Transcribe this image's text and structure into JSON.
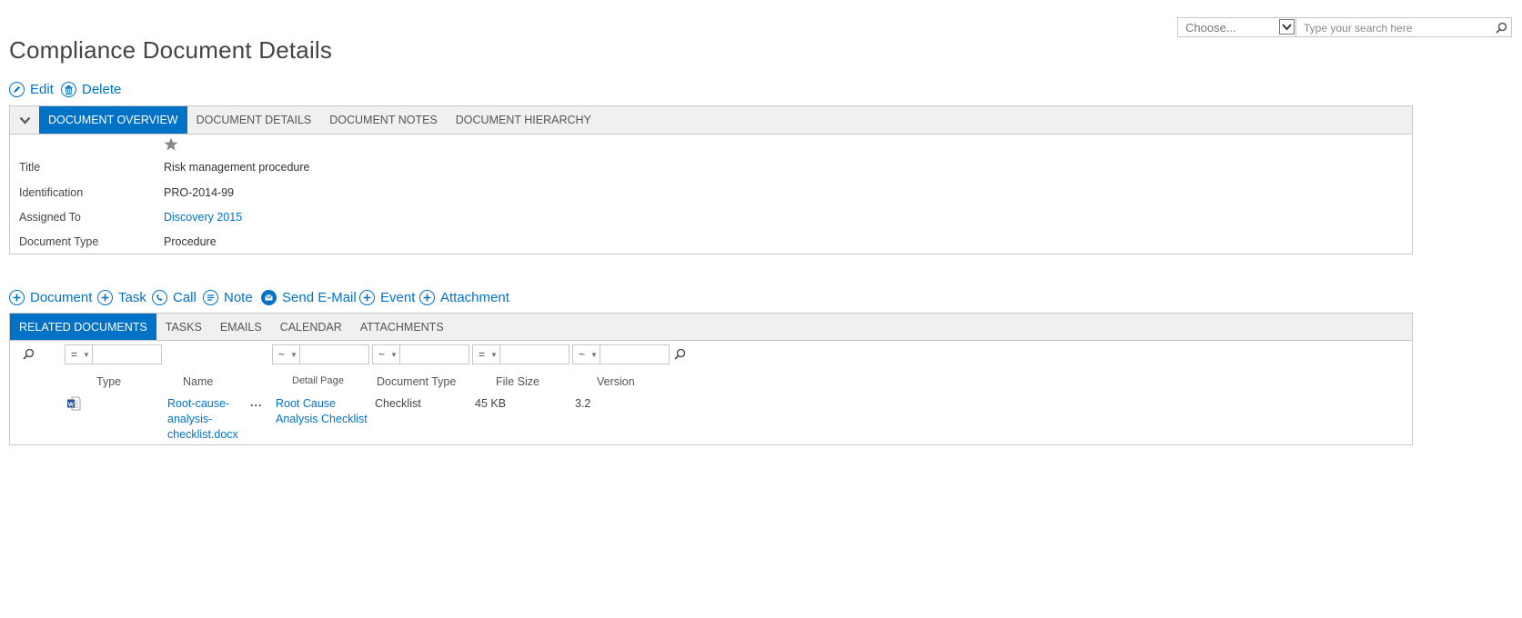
{
  "search": {
    "scope_placeholder": "Choose...",
    "placeholder": "Type your search here"
  },
  "page": {
    "title": "Compliance Document Details"
  },
  "actions": {
    "edit": "Edit",
    "delete": "Delete"
  },
  "overview_tabs": [
    "DOCUMENT OVERVIEW",
    "DOCUMENT DETAILS",
    "DOCUMENT NOTES",
    "DOCUMENT HIERARCHY"
  ],
  "fields": [
    {
      "label": "Title",
      "value": "Risk management procedure"
    },
    {
      "label": "Identification",
      "value": "PRO-2014-99"
    },
    {
      "label": "Assigned To",
      "value": "Discovery 2015"
    },
    {
      "label": "Document Type",
      "value": "Procedure"
    }
  ],
  "related_actions": [
    "Document",
    "Task",
    "Call",
    "Note",
    "Send E-Mail",
    "Event",
    "Attachment"
  ],
  "related_tabs": [
    "RELATED DOCUMENTS",
    "TASKS",
    "EMAILS",
    "CALENDAR",
    "ATTACHMENTS"
  ],
  "filters": {
    "ops": [
      "=",
      "~",
      "~",
      "=",
      "~"
    ]
  },
  "table": {
    "columns": [
      "Type",
      "Name",
      "Detail Page",
      "Document Type",
      "File Size",
      "Version"
    ],
    "rows": [
      {
        "type_icon": "word-document-icon",
        "name_lines": [
          "Root-cause-",
          "analysis-",
          "checklist.docx"
        ],
        "menu": "...",
        "detail_lines": [
          "Root Cause",
          "Analysis Checklist"
        ],
        "document_type": "Checklist",
        "file_size": "45 KB",
        "version": "3.2"
      }
    ]
  },
  "colors": {
    "accent": "#0072c6",
    "tabbar": "#f0f0f0",
    "border": "#c6c6c6"
  }
}
